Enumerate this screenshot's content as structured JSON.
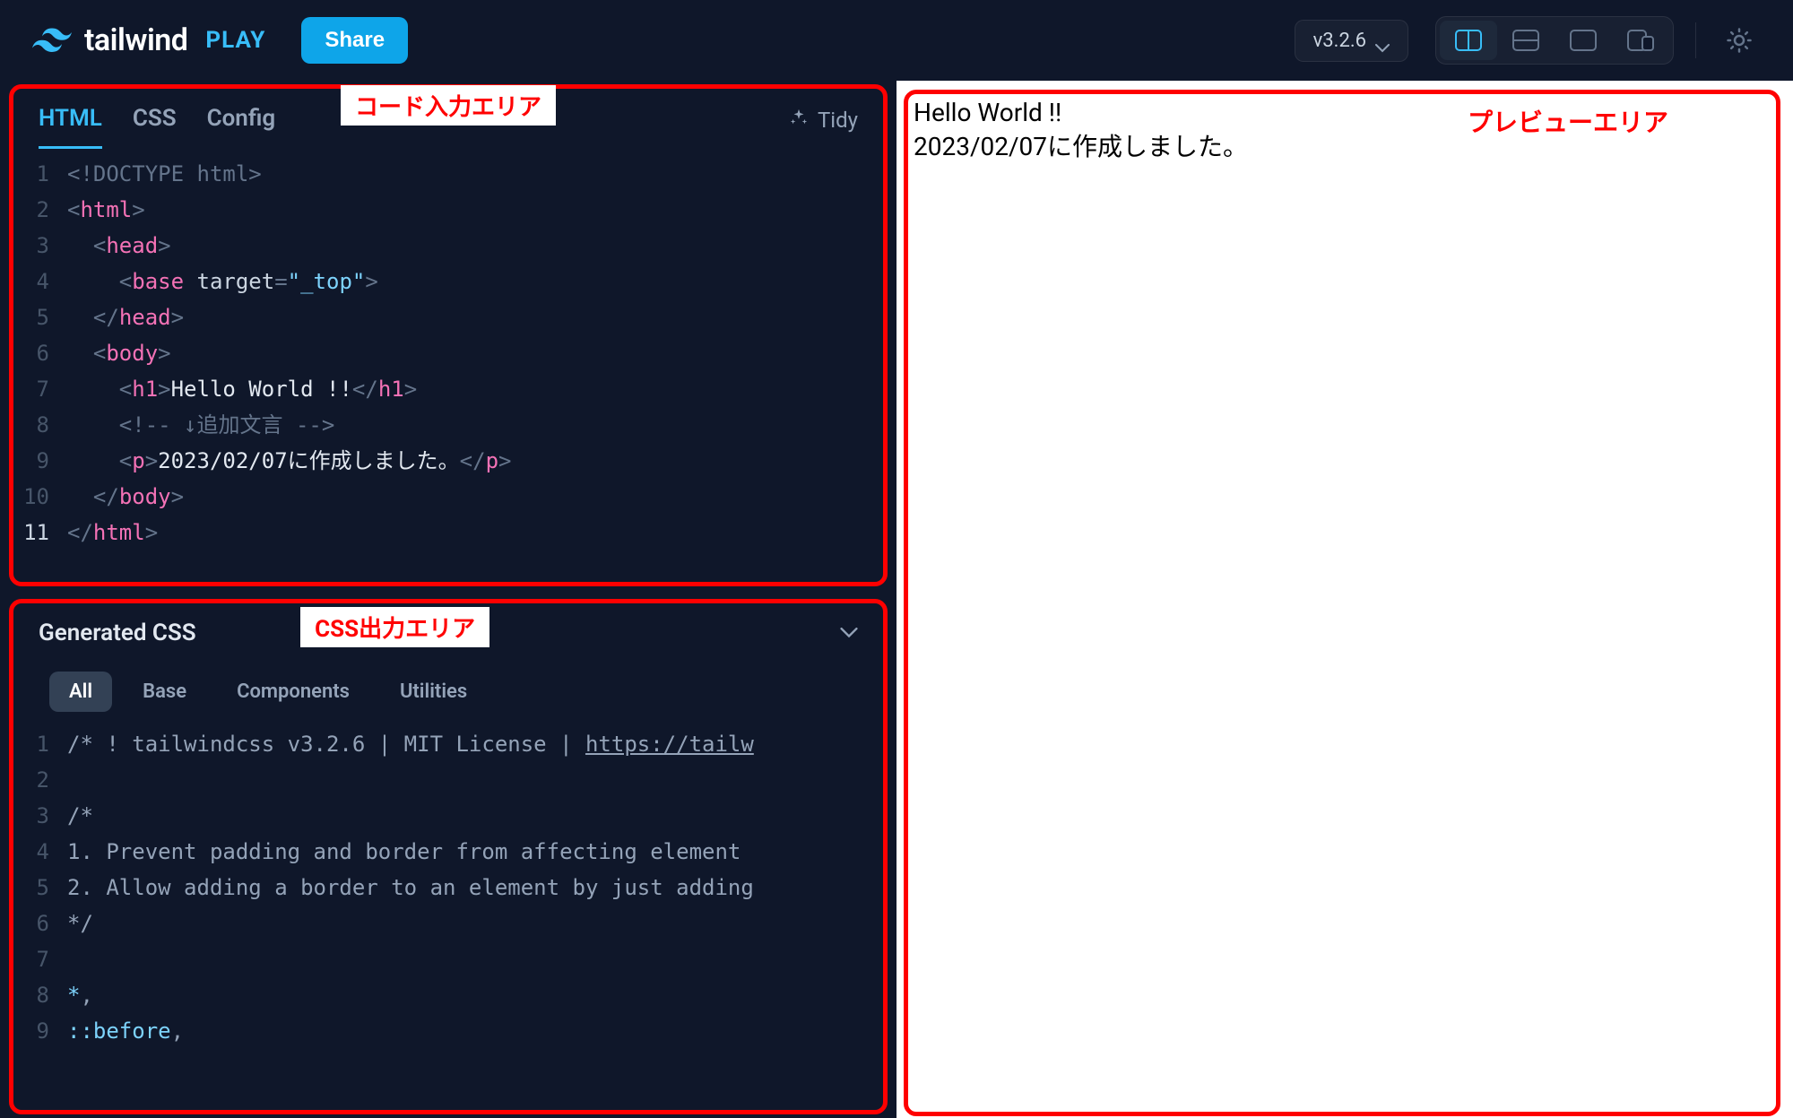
{
  "header": {
    "brand": "tailwind",
    "play": "PLAY",
    "share": "Share",
    "version": "v3.2.6"
  },
  "annotations": {
    "code_area": "コード入力エリア",
    "css_area": "CSS出力エリア",
    "preview_area": "プレビューエリア"
  },
  "tabs": {
    "html": "HTML",
    "css": "CSS",
    "config": "Config",
    "tidy": "Tidy"
  },
  "code": {
    "lines": [
      {
        "n": "1",
        "html": "<span class='tk-punc'>&lt;</span><span class='tk-doctype'>!DOCTYPE html</span><span class='tk-punc'>&gt;</span>"
      },
      {
        "n": "2",
        "html": "<span class='tk-punc'>&lt;</span><span class='tk-tag'>html</span><span class='tk-punc'>&gt;</span>"
      },
      {
        "n": "3",
        "html": "  <span class='tk-punc'>&lt;</span><span class='tk-tag'>head</span><span class='tk-punc'>&gt;</span>"
      },
      {
        "n": "4",
        "html": "    <span class='tk-punc'>&lt;</span><span class='tk-tag'>base</span> <span class='tk-attr'>target</span><span class='tk-punc'>=</span><span class='tk-str'>\"_top\"</span><span class='tk-punc'>&gt;</span>"
      },
      {
        "n": "5",
        "html": "  <span class='tk-punc'>&lt;/</span><span class='tk-tag'>head</span><span class='tk-punc'>&gt;</span>"
      },
      {
        "n": "6",
        "html": "  <span class='tk-punc'>&lt;</span><span class='tk-tag'>body</span><span class='tk-punc'>&gt;</span>"
      },
      {
        "n": "7",
        "html": "    <span class='tk-punc'>&lt;</span><span class='tk-tag'>h1</span><span class='tk-punc'>&gt;</span><span class='tk-text'>Hello World !!</span><span class='tk-punc'>&lt;/</span><span class='tk-tag'>h1</span><span class='tk-punc'>&gt;</span>"
      },
      {
        "n": "8",
        "html": "    <span class='tk-comment'>&lt;!-- ↓追加文言 --&gt;</span>"
      },
      {
        "n": "9",
        "html": "    <span class='tk-punc'>&lt;</span><span class='tk-tag'>p</span><span class='tk-punc'>&gt;</span><span class='tk-text'>2023/02/07に作成しました。</span><span class='tk-punc'>&lt;/</span><span class='tk-tag'>p</span><span class='tk-punc'>&gt;</span>"
      },
      {
        "n": "10",
        "html": "  <span class='tk-punc'>&lt;/</span><span class='tk-tag'>body</span><span class='tk-punc'>&gt;</span>"
      },
      {
        "n": "11",
        "html": "<span class='tk-punc'>&lt;/</span><span class='tk-tag'>html</span><span class='tk-punc'>&gt;</span>",
        "cur": true
      }
    ]
  },
  "generated": {
    "title": "Generated CSS",
    "filters": {
      "all": "All",
      "base": "Base",
      "components": "Components",
      "utilities": "Utilities"
    },
    "lines": [
      {
        "n": "1",
        "html": "<span class='css-code'>/* ! tailwindcss v3.2.6 | MIT License | <span class='css-link'>https://tailw</span></span>"
      },
      {
        "n": "2",
        "html": ""
      },
      {
        "n": "3",
        "html": "<span class='css-code'>/*</span>"
      },
      {
        "n": "4",
        "html": "<span class='css-code'>1. Prevent padding and border from affecting element </span>"
      },
      {
        "n": "5",
        "html": "<span class='css-code'>2. Allow adding a border to an element by just adding</span>"
      },
      {
        "n": "6",
        "html": "<span class='css-code'>*/</span>"
      },
      {
        "n": "7",
        "html": ""
      },
      {
        "n": "8",
        "html": "<span class='css-sel'>*</span><span class='css-code'>,</span>"
      },
      {
        "n": "9",
        "html": "<span class='css-sel'>::before</span><span class='css-code'>,</span>"
      }
    ]
  },
  "preview": {
    "h1": "Hello World !!",
    "p": "2023/02/07に作成しました。"
  }
}
